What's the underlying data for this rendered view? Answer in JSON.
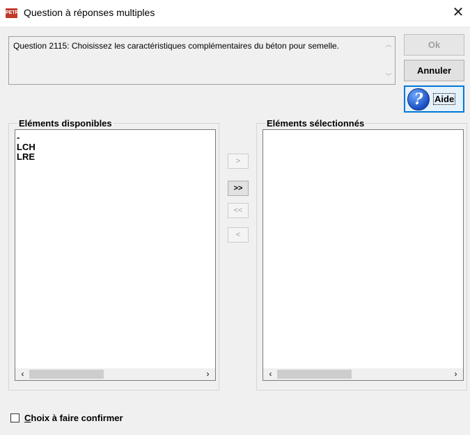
{
  "window": {
    "title": "Question à réponses multiples",
    "app_icon_text": "PETRA",
    "close_label": "✕"
  },
  "question": {
    "text": "Question 2115: Choisissez les caractéristiques complémentaires du béton pour semelle."
  },
  "buttons": {
    "ok": "Ok",
    "annuler": "Annuler",
    "aide": "Aide",
    "aide_icon": "?"
  },
  "available": {
    "title": "Eléments disponibles",
    "items": [
      "-",
      "LCH",
      "LRE"
    ]
  },
  "selected": {
    "title": "Eléments sélectionnés",
    "items": []
  },
  "move_buttons": {
    "add": ">",
    "add_all": ">>",
    "remove_all": "<<",
    "remove": "<"
  },
  "confirm": {
    "label_first": "C",
    "label_rest": "hoix à faire confirmer",
    "checked": false
  }
}
